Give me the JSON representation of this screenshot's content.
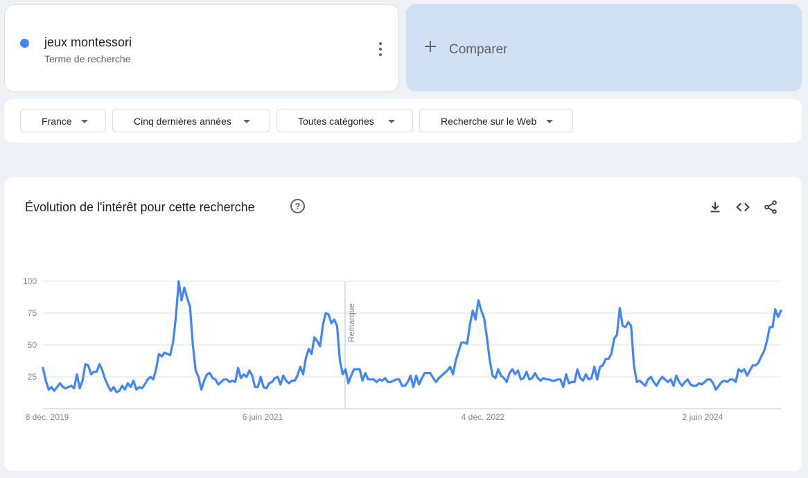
{
  "term": {
    "name": "jeux montessori",
    "subtitle": "Terme de recherche",
    "color": "#4285f4"
  },
  "compare": {
    "label": "Comparer"
  },
  "filters": [
    {
      "label": "France"
    },
    {
      "label": "Cinq dernières années"
    },
    {
      "label": "Toutes catégories"
    },
    {
      "label": "Recherche sur le Web"
    }
  ],
  "chart_card": {
    "title": "Évolution de l'intérêt pour cette recherche",
    "icons": [
      "help-icon",
      "download-icon",
      "embed-icon",
      "share-icon"
    ]
  },
  "chart_data": {
    "type": "line",
    "y_ticks": [
      "100",
      "75",
      "50",
      "25"
    ],
    "ylim": [
      0,
      100
    ],
    "x_tick_labels": [
      "8 déc. 2019",
      "6 juin 2021",
      "4 déc. 2022",
      "2 juin 2024"
    ],
    "annotation": "Remarque",
    "grid": true,
    "line_color": "#4285f4",
    "series": [
      {
        "values": [
          32,
          22,
          15,
          17,
          14,
          17,
          20,
          17,
          16,
          17,
          18,
          16,
          27,
          16,
          22,
          35,
          34,
          27,
          29,
          29,
          35,
          30,
          23,
          18,
          14,
          17,
          13,
          14,
          18,
          15,
          20,
          17,
          22,
          15,
          17,
          16,
          19,
          23,
          25,
          23,
          31,
          43,
          41,
          44,
          43,
          42,
          52,
          72,
          100,
          85,
          95,
          87,
          80,
          50,
          30,
          25,
          15,
          22,
          27,
          28,
          24,
          23,
          19,
          21,
          23,
          23,
          21,
          22,
          21,
          32,
          24,
          27,
          25,
          30,
          26,
          17,
          17,
          25,
          17,
          16,
          20,
          21,
          24,
          25,
          19,
          26,
          22,
          20,
          22,
          22,
          26,
          33,
          27,
          40,
          47,
          43,
          56,
          53,
          49,
          66,
          75,
          74,
          67,
          70,
          65,
          38,
          27,
          31,
          20,
          26,
          31,
          31,
          31,
          22,
          28,
          23,
          23,
          23,
          21,
          23,
          22,
          24,
          21,
          21,
          22,
          23,
          23,
          18,
          18,
          21,
          26,
          17,
          26,
          19,
          24,
          28,
          28,
          28,
          24,
          21,
          24,
          26,
          28,
          30,
          33,
          27,
          38,
          45,
          52,
          52,
          51,
          66,
          77,
          70,
          85,
          77,
          71,
          56,
          38,
          26,
          24,
          31,
          26,
          24,
          21,
          28,
          31,
          27,
          30,
          23,
          24,
          29,
          23,
          24,
          28,
          24,
          22,
          24,
          23,
          23,
          22,
          22,
          23,
          23,
          17,
          27,
          20,
          21,
          21,
          31,
          24,
          22,
          27,
          23,
          24,
          33,
          23,
          33,
          34,
          39,
          39,
          43,
          55,
          58,
          79,
          65,
          64,
          68,
          65,
          34,
          21,
          22,
          20,
          18,
          23,
          25,
          21,
          18,
          22,
          25,
          23,
          21,
          23,
          18,
          26,
          21,
          18,
          21,
          23,
          19,
          18,
          18,
          20,
          19,
          21,
          23,
          23,
          20,
          15,
          18,
          21,
          22,
          21,
          23,
          23,
          21,
          31,
          29,
          31,
          26,
          30,
          34,
          34,
          36,
          41,
          45,
          53,
          64,
          64,
          78,
          72,
          77
        ]
      }
    ]
  }
}
